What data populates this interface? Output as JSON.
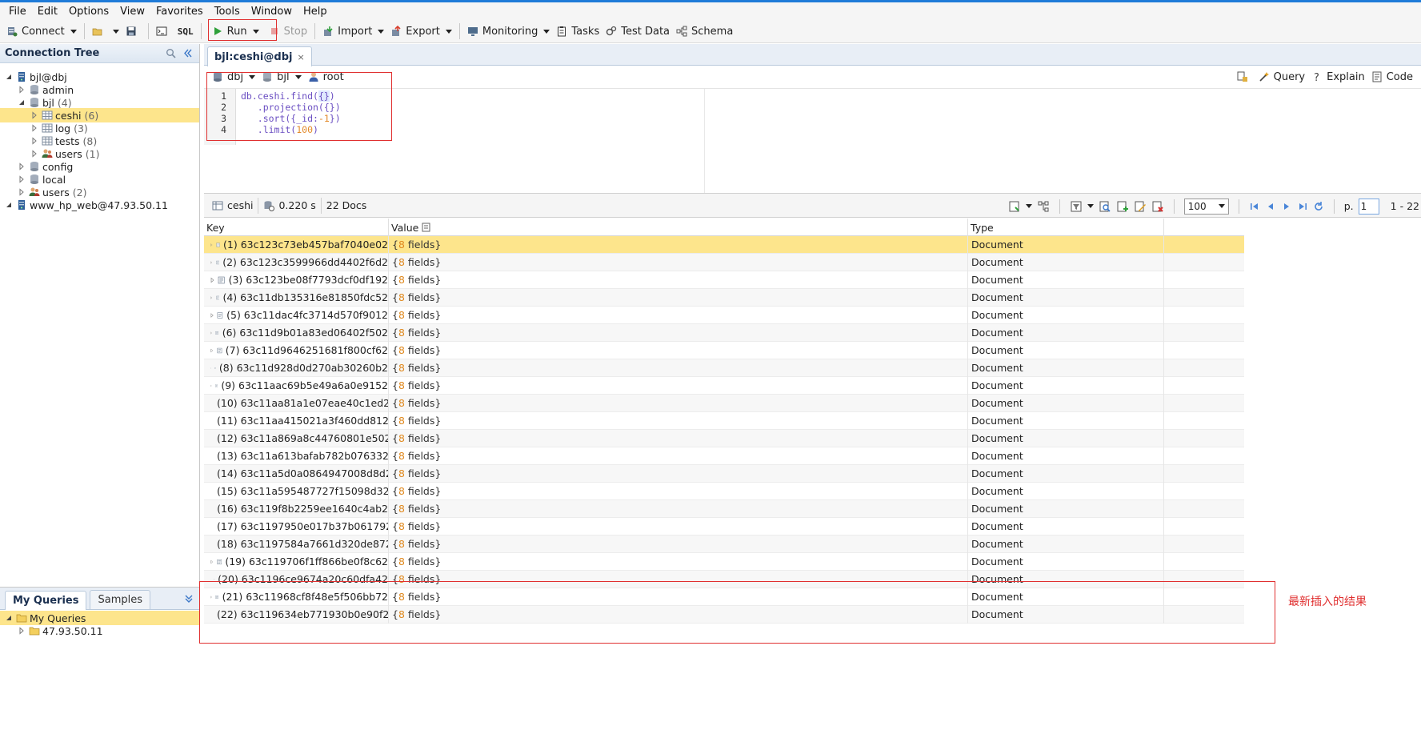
{
  "menu": [
    "File",
    "Edit",
    "Options",
    "View",
    "Favorites",
    "Tools",
    "Window",
    "Help"
  ],
  "toolbar": {
    "connect": "Connect",
    "sql": "SQL",
    "run": "Run",
    "stop": "Stop",
    "import": "Import",
    "export": "Export",
    "monitoring": "Monitoring",
    "tasks": "Tasks",
    "test_data": "Test Data",
    "schema": "Schema"
  },
  "connection_tree": {
    "title": "Connection Tree",
    "items": [
      {
        "label": "bjl@dbj",
        "count": "",
        "level": 0,
        "icon": "server-icon",
        "expanded": true
      },
      {
        "label": "admin",
        "count": "",
        "level": 1,
        "icon": "database-icon",
        "expanded": false
      },
      {
        "label": "bjl",
        "count": "(4)",
        "level": 1,
        "icon": "database-icon",
        "expanded": true
      },
      {
        "label": "ceshi",
        "count": "(6)",
        "level": 2,
        "icon": "collection-icon",
        "expanded": false,
        "selected": true
      },
      {
        "label": "log",
        "count": "(3)",
        "level": 2,
        "icon": "collection-icon",
        "expanded": false
      },
      {
        "label": "tests",
        "count": "(8)",
        "level": 2,
        "icon": "collection-icon",
        "expanded": false
      },
      {
        "label": "users",
        "count": "(1)",
        "level": 2,
        "icon": "users-icon",
        "expanded": false
      },
      {
        "label": "config",
        "count": "",
        "level": 1,
        "icon": "database-icon",
        "expanded": false
      },
      {
        "label": "local",
        "count": "",
        "level": 1,
        "icon": "database-icon",
        "expanded": false
      },
      {
        "label": "users",
        "count": "(2)",
        "level": 1,
        "icon": "users-icon",
        "expanded": false
      },
      {
        "label": "www_hp_web@47.93.50.11",
        "count": "",
        "level": 0,
        "icon": "server-icon",
        "expanded": true
      }
    ]
  },
  "queries_panel": {
    "tabs": [
      "My Queries",
      "Samples"
    ],
    "items": [
      {
        "label": "My Queries",
        "level": 0,
        "selected": true
      },
      {
        "label": "47.93.50.11",
        "level": 1,
        "selected": false
      }
    ]
  },
  "doc_tab": {
    "title": "bjl:ceshi@dbj",
    "close": "×"
  },
  "query_bar": {
    "connection": "dbj",
    "database": "bjl",
    "user": "root",
    "query": "Query",
    "explain": "Explain",
    "code": "Code"
  },
  "editor": {
    "line_numbers": [
      "1",
      "2",
      "3",
      "4"
    ]
  },
  "result_bar": {
    "collection": "ceshi",
    "time": "0.220 s",
    "docs": "22 Docs",
    "page_size": "100",
    "page_label": "p.",
    "page": "1",
    "range": "1 - 22"
  },
  "grid": {
    "columns": [
      "Key",
      "Value",
      "Type"
    ],
    "rows": [
      {
        "key": "(1) 63c123c73eb457baf7040e02",
        "value": "8 fields",
        "type": "Document"
      },
      {
        "key": "(2) 63c123c3599966dd4402f6d2",
        "value": "8 fields",
        "type": "Document"
      },
      {
        "key": "(3) 63c123be08f7793dcf0df192",
        "value": "8 fields",
        "type": "Document"
      },
      {
        "key": "(4) 63c11db135316e81850fdc52",
        "value": "8 fields",
        "type": "Document"
      },
      {
        "key": "(5) 63c11dac4fc3714d570f9012",
        "value": "8 fields",
        "type": "Document"
      },
      {
        "key": "(6) 63c11d9b01a83ed06402f502",
        "value": "8 fields",
        "type": "Document"
      },
      {
        "key": "(7) 63c11d9646251681f800cf62",
        "value": "8 fields",
        "type": "Document"
      },
      {
        "key": "(8) 63c11d928d0d270ab30260b2",
        "value": "8 fields",
        "type": "Document"
      },
      {
        "key": "(9) 63c11aac69b5e49a6a0e9152",
        "value": "8 fields",
        "type": "Document"
      },
      {
        "key": "(10) 63c11aa81a1e07eae40c1ed2",
        "value": "8 fields",
        "type": "Document"
      },
      {
        "key": "(11) 63c11aa415021a3f460dd812",
        "value": "8 fields",
        "type": "Document"
      },
      {
        "key": "(12) 63c11a869a8c44760801e502",
        "value": "8 fields",
        "type": "Document"
      },
      {
        "key": "(13) 63c11a613bafab782b076332",
        "value": "8 fields",
        "type": "Document"
      },
      {
        "key": "(14) 63c11a5d0a0864947008d8d2",
        "value": "8 fields",
        "type": "Document"
      },
      {
        "key": "(15) 63c11a595487727f15098d32",
        "value": "8 fields",
        "type": "Document"
      },
      {
        "key": "(16) 63c119f8b2259ee1640c4ab2",
        "value": "8 fields",
        "type": "Document"
      },
      {
        "key": "(17) 63c1197950e017b37b061792",
        "value": "8 fields",
        "type": "Document"
      },
      {
        "key": "(18) 63c1197584a7661d320de872",
        "value": "8 fields",
        "type": "Document"
      },
      {
        "key": "(19) 63c119706f1ff866be0f8c62",
        "value": "8 fields",
        "type": "Document"
      },
      {
        "key": "(20) 63c1196ce9674a20c60dfa42",
        "value": "8 fields",
        "type": "Document"
      },
      {
        "key": "(21) 63c11968cf8f48e5f506bb72",
        "value": "8 fields",
        "type": "Document"
      },
      {
        "key": "(22) 63c119634eb771930b0e90f2",
        "value": "8 fields",
        "type": "Document"
      }
    ]
  },
  "annotation": "最新插入的结果",
  "colors": {
    "selection": "#fde58c",
    "annotation_red": "#e03030",
    "accent": "#1f7bd8"
  }
}
